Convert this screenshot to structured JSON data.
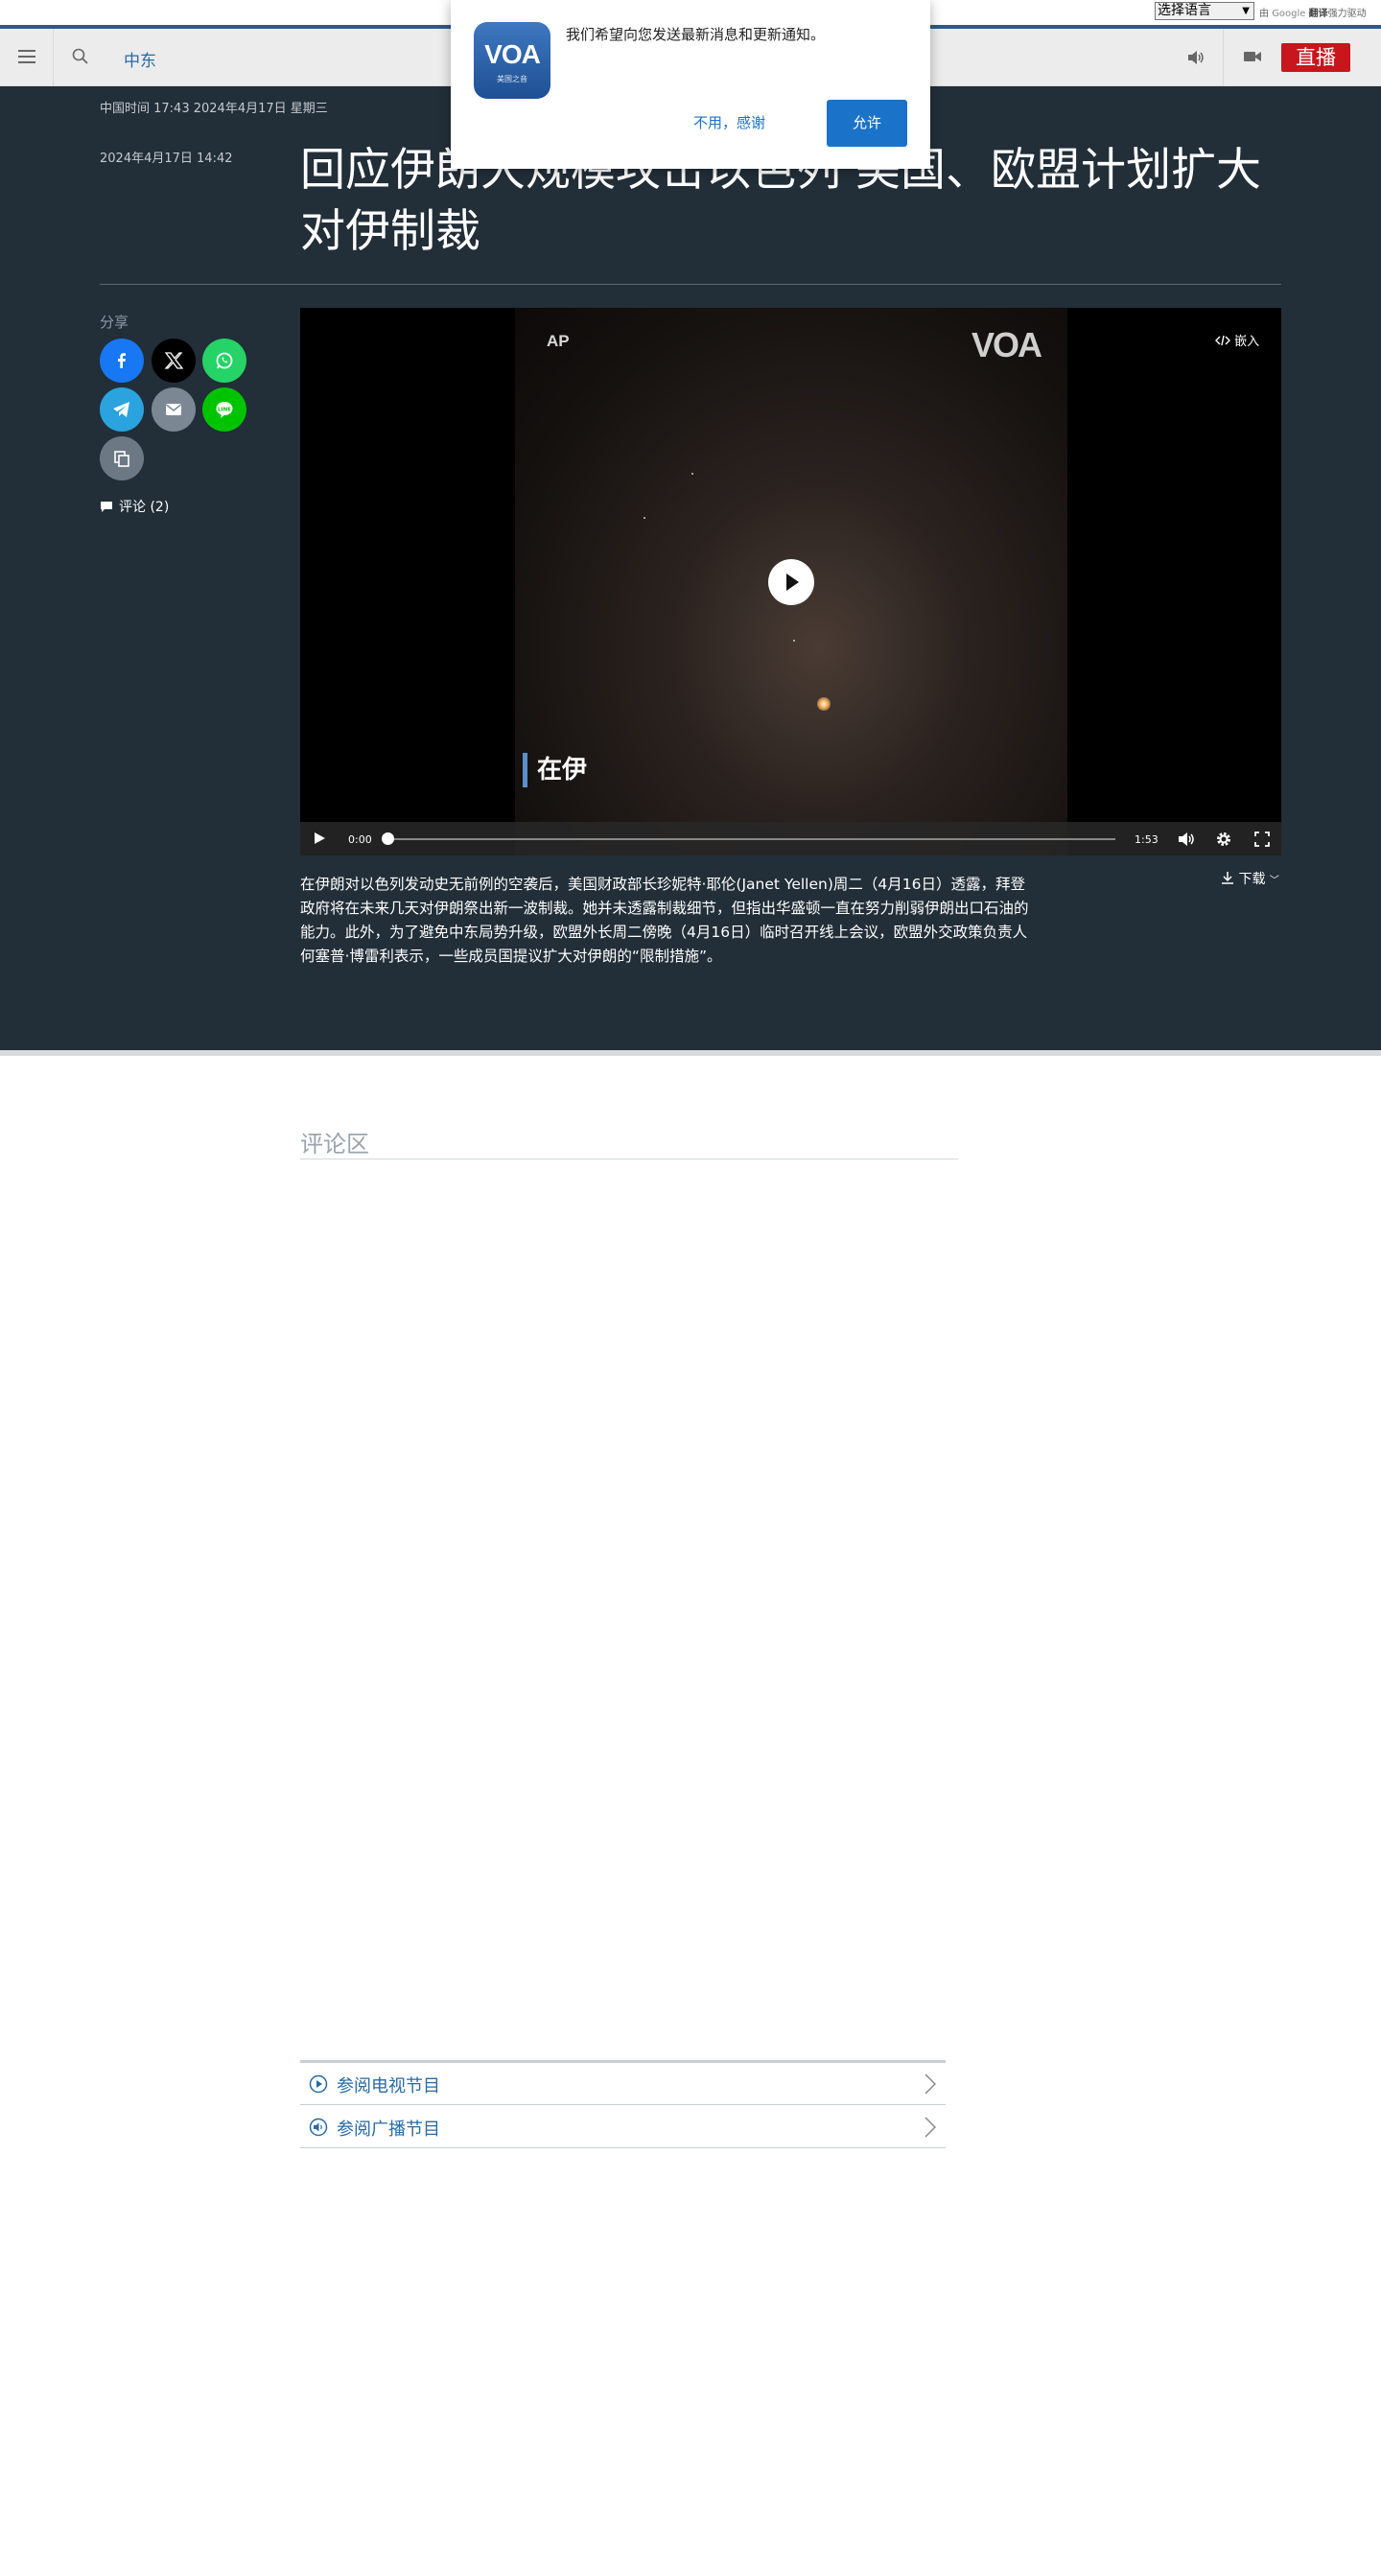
{
  "translate_bar": {
    "select_value": "选择语言",
    "powered_prefix": "由",
    "google": "Google",
    "translate": "翻译",
    "powered_suffix": "强力驱动"
  },
  "nav": {
    "section": "中东",
    "live": "直播"
  },
  "article": {
    "dateline": "中国时间 17:43 2024年4月17日 星期三",
    "published": "2024年4月17日 14:42",
    "title": "回应伊朗大规模攻击以色列 美国、欧盟计划扩大对伊制裁",
    "share_label": "分享",
    "comments_link": "评论 (2)",
    "summary": "在伊朗对以色列发动史无前例的空袭后，美国财政部长珍妮特·耶伦(Janet Yellen)周二（4月16日）透露，拜登政府将在未来几天对伊朗祭出新一波制裁。她并未透露制裁细节，但指出华盛顿一直在努力削弱伊朗出口石油的能力。此外，为了避免中东局势升级，欧盟外长周二傍晚（4月16日）临时召开线上会议，欧盟外交政策负责人何塞普·博雷利表示，一些成员国提议扩大对伊朗的“限制措施”。"
  },
  "player": {
    "source_logo": "AP",
    "watermark": "VOA",
    "embed": "嵌入",
    "caption": "在伊",
    "current_time": "0:00",
    "duration": "1:53",
    "progress": 0,
    "download": "下载"
  },
  "share_buttons": [
    {
      "name": "facebook",
      "color": "#1877f2"
    },
    {
      "name": "x",
      "color": "#000000"
    },
    {
      "name": "whatsapp",
      "color": "#25d366"
    },
    {
      "name": "telegram",
      "color": "#2aa3df"
    },
    {
      "name": "email",
      "color": "#7b8894"
    },
    {
      "name": "line",
      "color": "#00c300"
    },
    {
      "name": "copy-link",
      "color": "#6c7884"
    }
  ],
  "comments": {
    "title": "评论区"
  },
  "programs": [
    {
      "label": "参阅电视节目",
      "icon": "play-circle-icon"
    },
    {
      "label": "参阅广播节目",
      "icon": "speaker-icon"
    }
  ],
  "notification": {
    "message": "我们希望向您发送最新消息和更新通知。",
    "deny": "不用，感谢",
    "allow": "允许",
    "icon_text": "VOA",
    "icon_subtext": "美国之音"
  }
}
